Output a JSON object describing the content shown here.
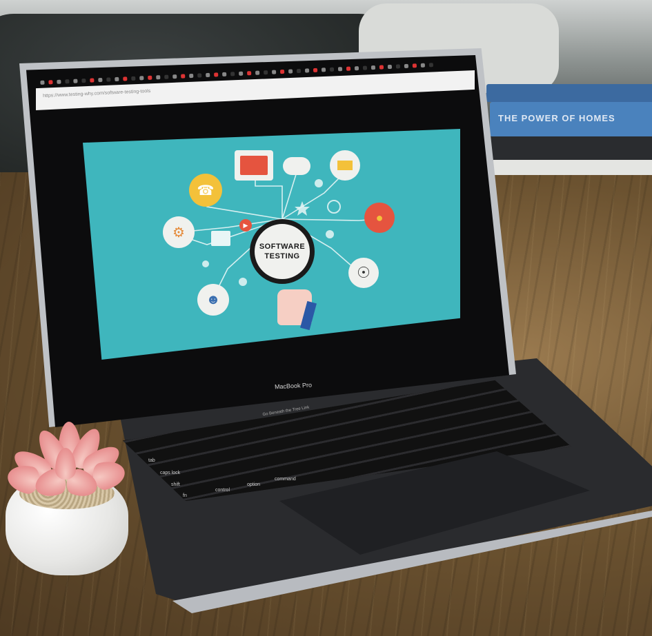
{
  "scene": {
    "description_tags": [
      "laptop",
      "succulent",
      "books",
      "wooden-table"
    ]
  },
  "laptop": {
    "brand_label": "MacBook Pro",
    "touchbar_text": "Go Beneath the Tree Link",
    "keys": [
      "tab",
      "caps lock",
      "shift",
      "fn",
      "control",
      "option",
      "command"
    ]
  },
  "browser": {
    "url_text": "https://www.testing-why.com/software-testing-tools"
  },
  "screen": {
    "headline_line1": "SOFTWARE",
    "headline_line2": "TESTING",
    "background_color": "#3fb6bd"
  },
  "books": {
    "spine_text": "THE POWER OF HOMES"
  },
  "colors": {
    "screen_teal": "#3fb6bd",
    "node_yellow": "#f3c13a",
    "node_red": "#e5543f",
    "node_white": "#f0f1ee",
    "table_wood": "#6b5230"
  }
}
